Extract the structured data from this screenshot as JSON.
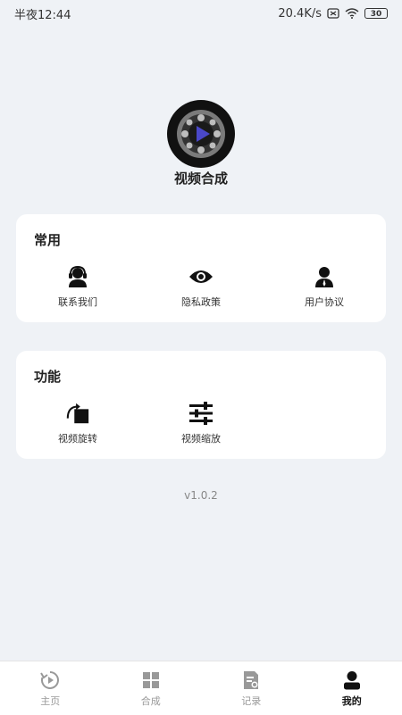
{
  "status": {
    "time": "半夜12:44",
    "network_speed": "20.4K/s",
    "battery": "30"
  },
  "app": {
    "name": "视频合成",
    "logo_icon": "video-play-reel-icon"
  },
  "common_section": {
    "title": "常用",
    "items": [
      {
        "label": "联系我们",
        "icon": "headset-support-icon"
      },
      {
        "label": "隐私政策",
        "icon": "eye-icon"
      },
      {
        "label": "用户协议",
        "icon": "user-icon"
      }
    ]
  },
  "features_section": {
    "title": "功能",
    "items": [
      {
        "label": "视频旋转",
        "icon": "rotate-icon"
      },
      {
        "label": "视频缩放",
        "icon": "sliders-icon"
      }
    ]
  },
  "version": "v1.0.2",
  "tabs": [
    {
      "label": "主页",
      "icon": "home-play-icon",
      "active": false
    },
    {
      "label": "合成",
      "icon": "grid-icon",
      "active": false
    },
    {
      "label": "记录",
      "icon": "record-file-icon",
      "active": false
    },
    {
      "label": "我的",
      "icon": "profile-icon",
      "active": true
    }
  ],
  "colors": {
    "background": "#eff2f6",
    "card": "#ffffff",
    "active_tab": "#111111",
    "inactive_tab": "#999999"
  }
}
